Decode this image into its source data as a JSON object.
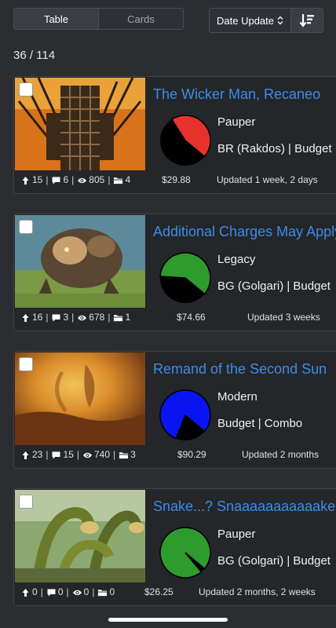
{
  "view_toggle": {
    "table_label": "Table",
    "cards_label": "Cards",
    "active": "Table"
  },
  "sort": {
    "selected": "Date Update",
    "order_icon": "sort-descending-icon"
  },
  "result_count": "36 / 114",
  "decks": [
    {
      "title": "The Wicker Man, Recaneo",
      "format": "Pauper",
      "tags": "BR (Rakdos) | Budget",
      "likes": "15",
      "comments": "6",
      "views": "805",
      "folders": "4",
      "price": "$29.88",
      "updated": "Updated 1 week, 2 days",
      "pie_color": "#e5322d",
      "pie_fraction": 0.45,
      "art": "wicker"
    },
    {
      "title": "Additional Charges May Apply",
      "format": "Legacy",
      "tags": "BG (Golgari) | Budget",
      "likes": "16",
      "comments": "3",
      "views": "678",
      "folders": "1",
      "price": "$74.66",
      "updated": "Updated 3 weeks",
      "pie_color": "#2e9b2e",
      "pie_fraction": 0.6,
      "art": "beast"
    },
    {
      "title": "Remand of the Second Sun",
      "format": "Modern",
      "tags": "Budget | Combo",
      "likes": "23",
      "comments": "15",
      "views": "740",
      "folders": "3",
      "price": "$90.29",
      "updated": "Updated 2 months",
      "pie_color": "#0a14f0",
      "pie_fraction": 0.8,
      "art": "desert"
    },
    {
      "title": "Snake...? Snaaaaaaaaaaake!",
      "format": "Pauper",
      "tags": "BG (Golgari) | Budget",
      "likes": "0",
      "comments": "0",
      "views": "0",
      "folders": "0",
      "price": "$26.25",
      "updated": "Updated 2 months, 2 weeks",
      "pie_color": "#2e9b2e",
      "pie_fraction": 0.97,
      "art": "hydra"
    }
  ],
  "icons": {
    "likes": "arrow-up-icon",
    "comments": "comment-icon",
    "views": "eye-icon",
    "folders": "folder-icon"
  }
}
